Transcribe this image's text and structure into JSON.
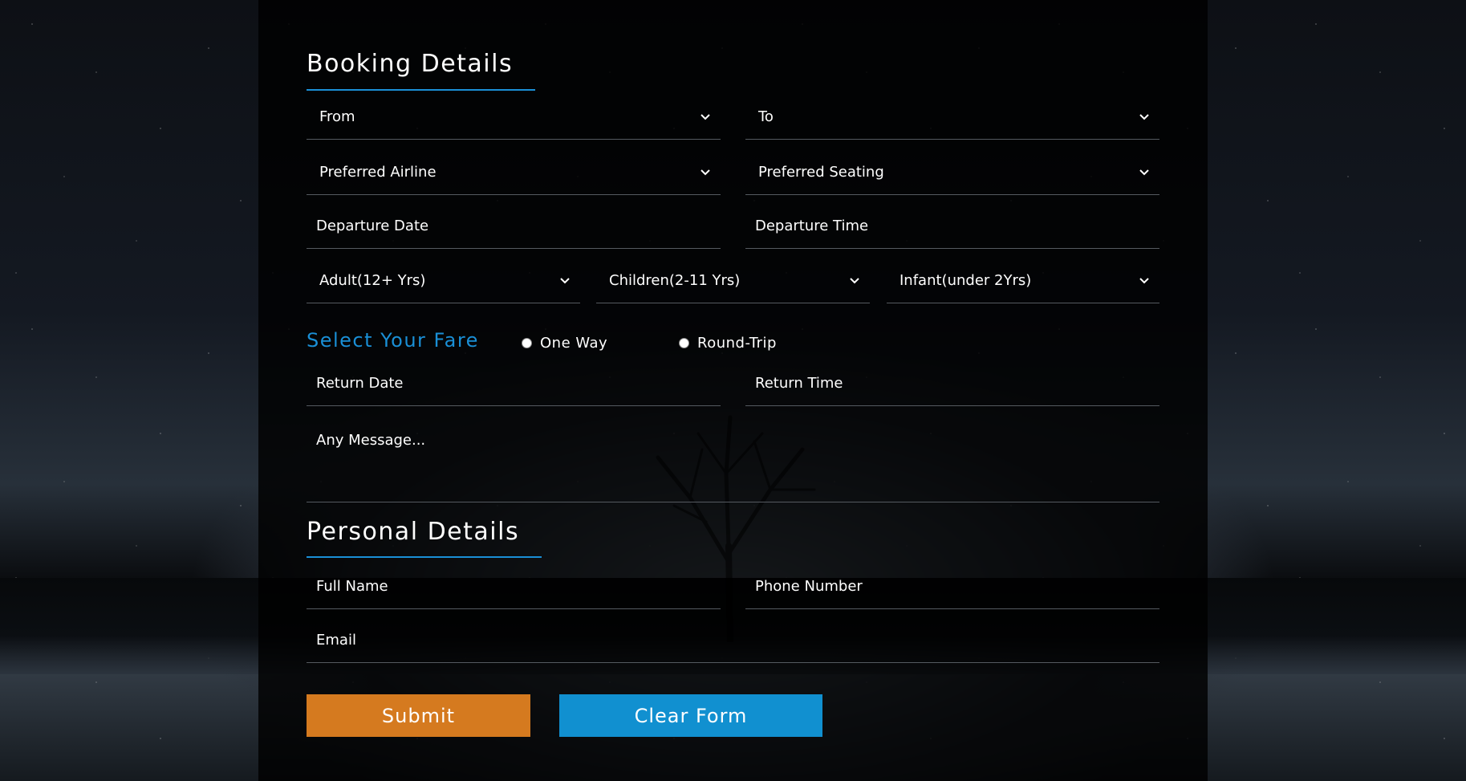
{
  "colors": {
    "accent": "#1a8fd6",
    "submit": "#d57a1f",
    "clear": "#1190d0"
  },
  "booking": {
    "title": "Booking Details",
    "from": "From",
    "to": "To",
    "airline": "Preferred Airline",
    "seating": "Preferred Seating",
    "departure_date": "Departure Date",
    "departure_time": "Departure Time",
    "adult": "Adult(12+ Yrs)",
    "children": "Children(2-11 Yrs)",
    "infant": "Infant(under 2Yrs)"
  },
  "fare": {
    "label": "Select Your Fare",
    "one_way": "One Way",
    "round_trip": "Round-Trip"
  },
  "return": {
    "date": "Return Date",
    "time": "Return Time"
  },
  "message": {
    "placeholder": "Any Message..."
  },
  "personal": {
    "title": "Personal Details",
    "full_name": "Full Name",
    "phone": "Phone Number",
    "email": "Email"
  },
  "buttons": {
    "submit": "Submit",
    "clear": "Clear Form"
  }
}
